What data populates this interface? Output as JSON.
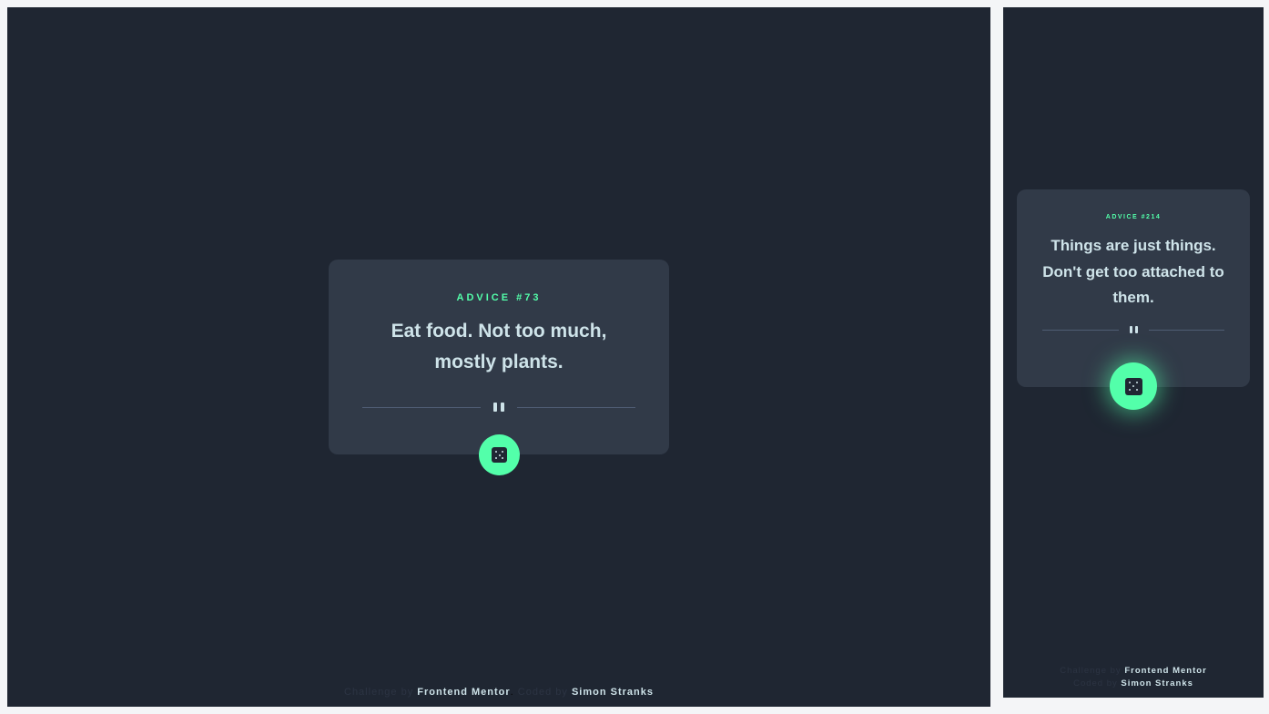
{
  "desktop": {
    "advice_label": "ADVICE #73",
    "quote": "Eat food. Not too much, mostly plants.",
    "attribution": {
      "challenge_prefix": "Challenge by",
      "challenge_link": "Frontend Mentor",
      "coded_prefix": "Coded by",
      "coded_link": "Simon Stranks"
    }
  },
  "mobile": {
    "advice_label": "ADVICE #214",
    "quote": "Things are just things. Don't get too attached to them.",
    "attribution": {
      "challenge_prefix": "Challenge by",
      "challenge_link": "Frontend Mentor",
      "coded_prefix": "Coded by",
      "coded_link": "Simon Stranks"
    }
  },
  "icons": {
    "divider": "pause-icon",
    "button": "dice-icon"
  },
  "colors": {
    "background": "#1f2632",
    "card": "#313a48",
    "accent": "#53ffaa",
    "text": "#cee3e9",
    "divider": "#4f5d74"
  }
}
